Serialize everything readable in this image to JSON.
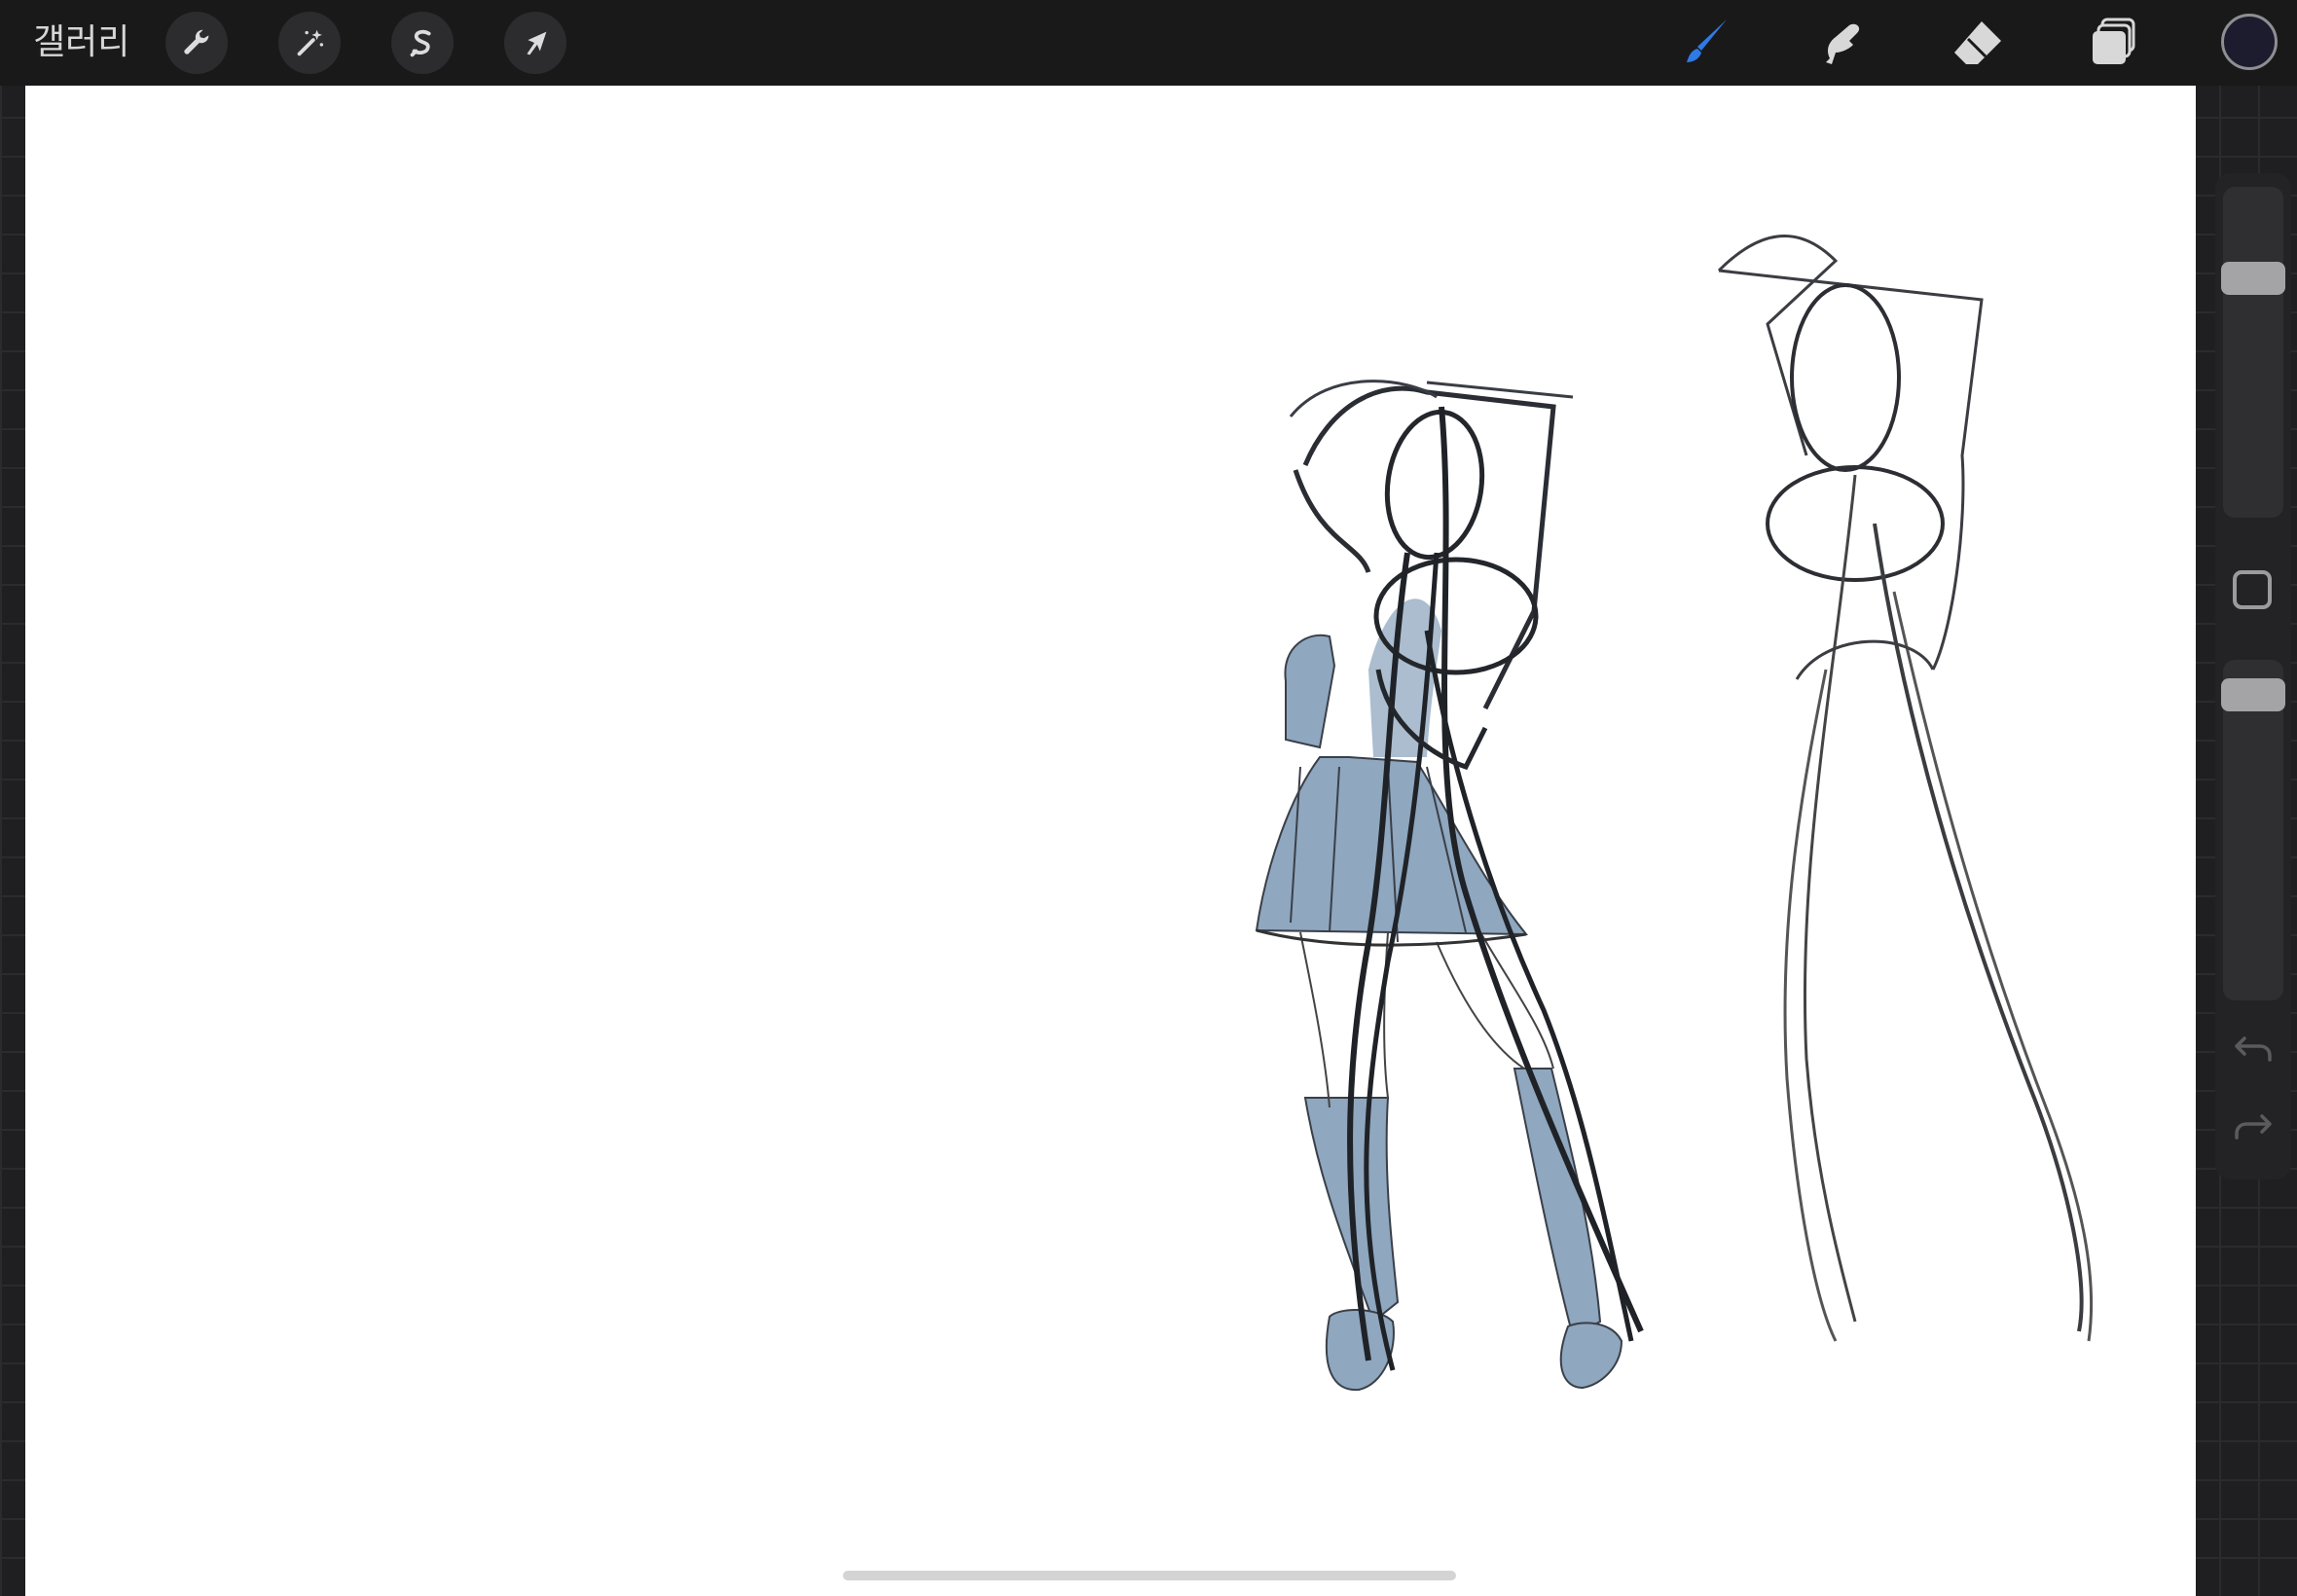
{
  "app": {
    "gallery_label": "갤러리"
  },
  "topbar": {
    "left_tools": [
      {
        "id": "actions",
        "icon": "wrench-icon"
      },
      {
        "id": "adjustments",
        "icon": "magic-wand-icon"
      },
      {
        "id": "selection",
        "icon": "selection-s-icon"
      },
      {
        "id": "transform",
        "icon": "arrow-cursor-icon"
      }
    ],
    "right_tools": [
      {
        "id": "brush",
        "icon": "brush-icon",
        "active": true
      },
      {
        "id": "smudge",
        "icon": "smudge-finger-icon",
        "active": false
      },
      {
        "id": "eraser",
        "icon": "eraser-icon",
        "active": false
      },
      {
        "id": "layers",
        "icon": "layers-icon",
        "active": false
      }
    ],
    "current_color": "#1c1c2e"
  },
  "colors": {
    "accent_active": "#2f7ae5",
    "icon_inactive": "#d8d8d8",
    "fill_blue": "#8fa7bf"
  },
  "sidebar": {
    "brush_size_level": 0.25,
    "opacity_level": 0.06,
    "undo_icon": "undo-arrow-icon",
    "redo_icon": "redo-arrow-icon",
    "modify_icon": "square-modify-icon"
  }
}
